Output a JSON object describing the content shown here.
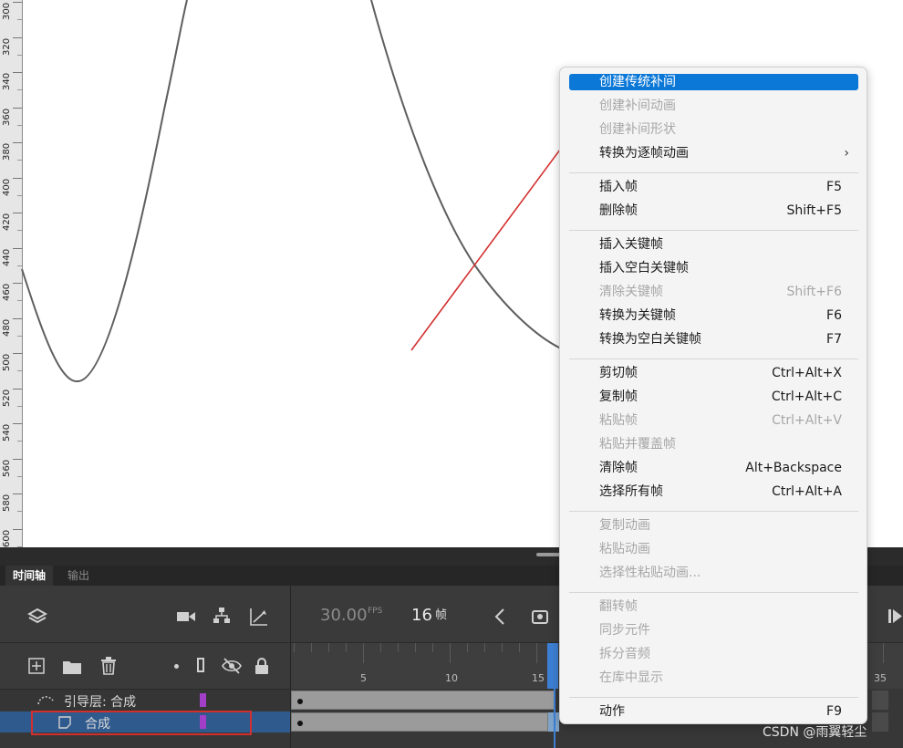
{
  "ruler": {
    "labels": [
      "300",
      "320",
      "340",
      "360",
      "380",
      "400",
      "420",
      "440",
      "460",
      "480",
      "500",
      "520",
      "540",
      "560",
      "580",
      "600"
    ]
  },
  "panel": {
    "tabs": [
      {
        "label": "时间轴"
      },
      {
        "label": "输出"
      }
    ],
    "fps_value": "30.00",
    "fps_unit": "FPS",
    "current_frame": "16",
    "frame_unit": "帧",
    "frame_labels": [
      "5",
      "10",
      "15",
      "35"
    ]
  },
  "layers": [
    {
      "name": "引导层: 合成",
      "color": "#a13fc9"
    },
    {
      "name": "合成",
      "color": "#a13fc9",
      "selected": true
    }
  ],
  "context_menu": {
    "groups": [
      [
        {
          "label": "创建传统补间",
          "shortcut": "",
          "enabled": true,
          "highlighted": true
        },
        {
          "label": "创建补间动画",
          "shortcut": "",
          "enabled": false
        },
        {
          "label": "创建补间形状",
          "shortcut": "",
          "enabled": false
        },
        {
          "label": "转换为逐帧动画",
          "shortcut": "",
          "enabled": true,
          "submenu": true
        }
      ],
      [
        {
          "label": "插入帧",
          "shortcut": "F5",
          "enabled": true
        },
        {
          "label": "删除帧",
          "shortcut": "Shift+F5",
          "enabled": true
        }
      ],
      [
        {
          "label": "插入关键帧",
          "shortcut": "",
          "enabled": true
        },
        {
          "label": "插入空白关键帧",
          "shortcut": "",
          "enabled": true
        },
        {
          "label": "清除关键帧",
          "shortcut": "Shift+F6",
          "enabled": false
        },
        {
          "label": "转换为关键帧",
          "shortcut": "F6",
          "enabled": true
        },
        {
          "label": "转换为空白关键帧",
          "shortcut": "F7",
          "enabled": true
        }
      ],
      [
        {
          "label": "剪切帧",
          "shortcut": "Ctrl+Alt+X",
          "enabled": true
        },
        {
          "label": "复制帧",
          "shortcut": "Ctrl+Alt+C",
          "enabled": true
        },
        {
          "label": "粘贴帧",
          "shortcut": "Ctrl+Alt+V",
          "enabled": false
        },
        {
          "label": "粘贴并覆盖帧",
          "shortcut": "",
          "enabled": false
        },
        {
          "label": "清除帧",
          "shortcut": "Alt+Backspace",
          "enabled": true
        },
        {
          "label": "选择所有帧",
          "shortcut": "Ctrl+Alt+A",
          "enabled": true
        }
      ],
      [
        {
          "label": "复制动画",
          "shortcut": "",
          "enabled": false
        },
        {
          "label": "粘贴动画",
          "shortcut": "",
          "enabled": false
        },
        {
          "label": "选择性粘贴动画...",
          "shortcut": "",
          "enabled": false
        }
      ],
      [
        {
          "label": "翻转帧",
          "shortcut": "",
          "enabled": false
        },
        {
          "label": "同步元件",
          "shortcut": "",
          "enabled": false
        },
        {
          "label": "拆分音频",
          "shortcut": "",
          "enabled": false
        },
        {
          "label": "在库中显示",
          "shortcut": "",
          "enabled": false
        }
      ],
      [
        {
          "label": "动作",
          "shortcut": "F9",
          "enabled": true
        }
      ]
    ],
    "submenu_glyph": "›"
  },
  "watermark": "CSDN @雨翼轻尘",
  "colors": {
    "highlight": "#0b78d7",
    "annotation": "#d32f2f",
    "playhead": "#3d7fd3",
    "layer_selected": "#2f5a8e"
  },
  "icons": [
    "layers-icon",
    "camera-icon",
    "hierarchy-icon",
    "graph-icon",
    "add-layer-icon",
    "folder-icon",
    "trash-icon",
    "dot-icon",
    "outline-icon",
    "eye-hidden-icon",
    "lock-icon",
    "chevron-left-icon",
    "camera-snapshot-icon",
    "play-icon"
  ]
}
